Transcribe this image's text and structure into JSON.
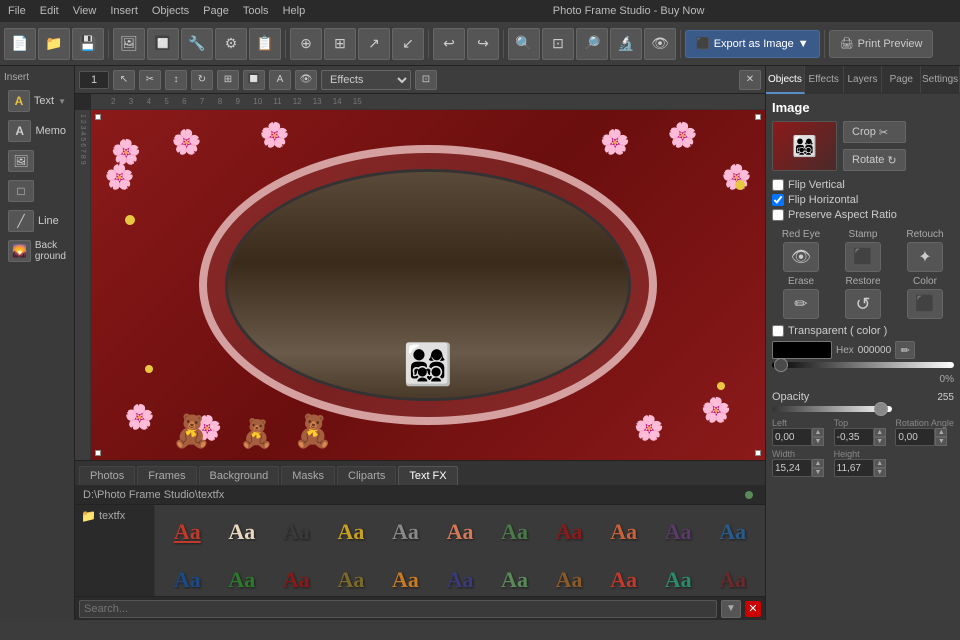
{
  "titlebar": {
    "menu_items": [
      "File",
      "Edit",
      "View",
      "Insert",
      "Objects",
      "Page",
      "Tools",
      "View",
      "Help"
    ],
    "app_name": "Photo Frame Studio - Buy Now"
  },
  "toolbar": {
    "export_label": "Export as Image",
    "print_label": "Print Preview"
  },
  "left_sidebar": {
    "insert_label": "Insert",
    "tools": [
      {
        "label": "Text",
        "icon": "A"
      },
      {
        "label": "Memo",
        "icon": "A"
      },
      {
        "label": "Image",
        "icon": "🖼"
      },
      {
        "label": "Shape",
        "icon": "□"
      },
      {
        "label": "Line",
        "icon": "/"
      },
      {
        "label": "Back ground",
        "icon": "🌄"
      }
    ]
  },
  "canvas": {
    "page_num": "1",
    "effects_label": "Effects"
  },
  "bottom_panel": {
    "tabs": [
      "Photos",
      "Frames",
      "Background",
      "Masks",
      "Cliparts",
      "Text FX"
    ],
    "active_tab": "Text FX",
    "path": "D:\\Photo Frame Studio\\textfx",
    "folder_item": "textfx"
  },
  "textfx_items_row1": [
    {
      "label": "Aa",
      "color": "#c0392b",
      "style": "bold",
      "underline": true
    },
    {
      "label": "Aa",
      "color": "#e8d8c0",
      "style": "bold"
    },
    {
      "label": "Aa",
      "color": "#3a3a3a",
      "style": "bold"
    },
    {
      "label": "Aa",
      "color": "#c8a020",
      "style": "bold"
    },
    {
      "label": "Aa",
      "color": "#888",
      "style": "bold"
    },
    {
      "label": "Aa",
      "color": "#d4785a",
      "style": "bold"
    },
    {
      "label": "Aa",
      "color": "#4a7a4a",
      "style": "bold"
    },
    {
      "label": "Aa",
      "color": "#8b1a1a",
      "style": "bold"
    },
    {
      "label": "Aa",
      "color": "#c8603a",
      "style": "bold"
    },
    {
      "label": "Aa",
      "color": "#5a3a6a",
      "style": "bold"
    },
    {
      "label": "Aa",
      "color": "#2a5a8a",
      "style": "bold"
    }
  ],
  "textfx_items_row2": [
    {
      "label": "Aa",
      "color": "#1a4a8a",
      "style": "bold"
    },
    {
      "label": "Aa",
      "color": "#2a7a2a",
      "style": "bold"
    },
    {
      "label": "Aa",
      "color": "#8a1a1a",
      "style": "bold"
    },
    {
      "label": "Aa",
      "color": "#7a6a2a",
      "style": "bold"
    },
    {
      "label": "Aa",
      "color": "#c87a20",
      "style": "bold"
    },
    {
      "label": "Aa",
      "color": "#3a3a7a",
      "style": "bold"
    },
    {
      "label": "Aa",
      "color": "#5a8a5a",
      "style": "bold"
    },
    {
      "label": "Aa",
      "color": "#8a5a2a",
      "style": "bold"
    },
    {
      "label": "Aa",
      "color": "#c0392b",
      "style": "bold"
    },
    {
      "label": "Aa",
      "color": "#2a8a6a",
      "style": "bold"
    },
    {
      "label": "Aa",
      "color": "#6a2a2a",
      "style": "bold"
    }
  ],
  "right_panel": {
    "tabs": [
      "Objects",
      "Effects",
      "Layers",
      "Page",
      "Settings"
    ],
    "active_tab": "Objects",
    "section_title": "Image",
    "crop_label": "Crop",
    "rotate_label": "Rotate",
    "flip_vertical_label": "Flip Vertical",
    "flip_horizontal_label": "Flip Horizontal",
    "preserve_aspect_label": "Preserve Aspect Ratio",
    "tool_sections": [
      {
        "label": "Red Eye",
        "icon": "👁"
      },
      {
        "label": "Stamp",
        "icon": "📋"
      },
      {
        "label": "Retouch",
        "icon": "✨"
      },
      {
        "label": "Erase",
        "icon": "✏"
      },
      {
        "label": "Restore",
        "icon": "↺"
      },
      {
        "label": "Color",
        "icon": "🎨"
      }
    ],
    "transparent_label": "Transparent ( color )",
    "hex_label": "Hex",
    "hex_value": "000000",
    "opacity_label": "Opacity",
    "opacity_value": "255",
    "opacity_pct": "0%",
    "left_label": "Left",
    "left_value": "0,00",
    "top_label": "Top",
    "top_value": "-0,35",
    "width_label": "Width",
    "width_value": "15,24",
    "height_label": "Height",
    "height_value": "11,67",
    "rotation_label": "Rotation Angle",
    "rotation_value": "0,00"
  },
  "search": {
    "placeholder": "Search...",
    "button_label": "▼"
  }
}
